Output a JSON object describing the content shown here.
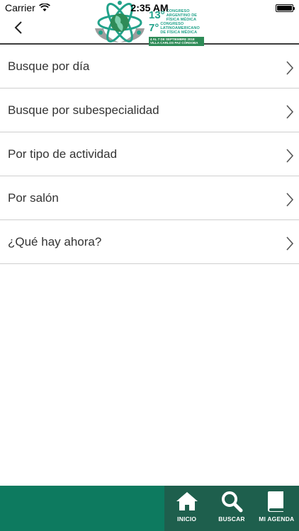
{
  "status_bar": {
    "carrier": "Carrier",
    "time": "2:35 AM"
  },
  "logo": {
    "edition_1": "13°",
    "title_1": "CONGRESO ARGENTINO DE FÍSICA MÉDICA",
    "edition_2": "7°",
    "title_2": "CONGRESO LATINOAMERICANO DE FÍSICA MÉDICA",
    "dates": "4 AL 7 DE SEPTIEMBRE 2018",
    "place": "VILLA CARLOS PAZ CÓRDOBA"
  },
  "menu": {
    "items": [
      {
        "label": "Busque por día"
      },
      {
        "label": "Busque por subespecialidad"
      },
      {
        "label": "Por tipo de actividad"
      },
      {
        "label": "Por salón"
      },
      {
        "label": "¿Qué hay ahora?"
      }
    ]
  },
  "tab_bar": {
    "tabs": [
      {
        "label": "INICIO",
        "icon": "home-icon"
      },
      {
        "label": "BUSCAR",
        "icon": "search-icon"
      },
      {
        "label": "MI AGENDA",
        "icon": "book-icon"
      }
    ]
  },
  "colors": {
    "tab_bar_bg": "#0d7a5f",
    "tab_group_bg": "#1e5f4d",
    "logo_teal": "#22a28a",
    "logo_green": "#2e8b57"
  }
}
